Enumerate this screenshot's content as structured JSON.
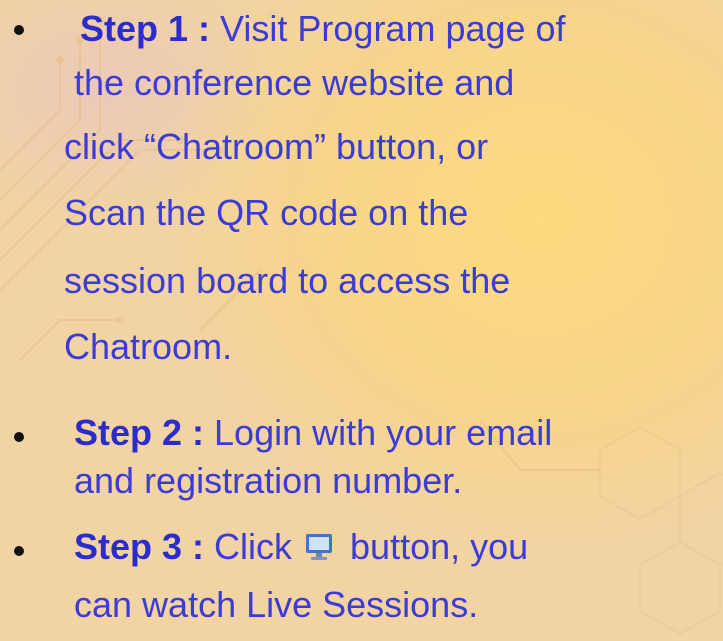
{
  "steps": [
    {
      "label": "Step 1 :",
      "lines": [
        " Visit Program page of",
        "the conference website and",
        "click “Chatroom” button, or",
        "Scan the QR code on the",
        "session board to access the",
        "Chatroom."
      ]
    },
    {
      "label": "Step 2 :",
      "lines": [
        " Login with your email",
        "and registration number."
      ]
    },
    {
      "label": "Step 3 :",
      "lines": [
        " Click ",
        " button, you",
        "can watch Live Sessions."
      ],
      "icon": "monitor-icon"
    }
  ],
  "colors": {
    "text": "#3b3bd6",
    "bullet": "#111111",
    "background": "#f1d3a4"
  }
}
